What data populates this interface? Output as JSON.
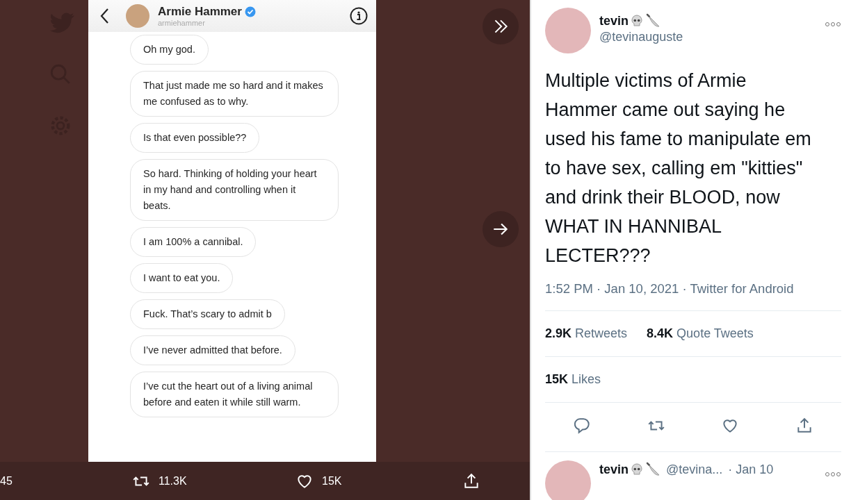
{
  "viewer": {
    "image": {
      "contact_name": "Armie Hammer",
      "contact_handle": "armiehammer",
      "verified": true,
      "messages": [
        "Oh my god.",
        "That just made me so hard and it makes me confused as to why.",
        "Is that even possible??",
        "So hard. Thinking of holding your heart in my hand and controlling when it beats.",
        "I am 100% a cannibal.",
        "I want to eat you.",
        "Fuck. That’s scary to admit b",
        "I’ve never admitted that before.",
        "I’ve cut the heart out of a living animal before and eaten it while still warm."
      ]
    },
    "actions": [
      {
        "kind": "count",
        "count": "45"
      },
      {
        "kind": "retweet",
        "count": "11.3K"
      },
      {
        "kind": "like",
        "count": "15K"
      },
      {
        "kind": "share"
      }
    ]
  },
  "tweet": {
    "name": "tevin",
    "handle": "@tevinauguste",
    "text": "Multiple victims of Armie Hammer came out saying he used his fame to manipulate em to have sex, calling em \"kitties\" and drink their BLOOD, now WHAT IN HANNIBAL LECTER???",
    "meta": "1:52 PM · Jan 10, 2021 · Twitter for Android",
    "stats": [
      {
        "count": "2.9K",
        "label": "Retweets"
      },
      {
        "count": "8.4K",
        "label": "Quote Tweets"
      }
    ],
    "likes": {
      "count": "15K",
      "label": "Likes"
    },
    "actions": [
      {
        "kind": "reply"
      },
      {
        "kind": "retweet"
      },
      {
        "kind": "like"
      },
      {
        "kind": "share"
      }
    ],
    "reply": {
      "name": "tevin",
      "handle": "@tevina...",
      "date": "· Jan 10"
    }
  }
}
